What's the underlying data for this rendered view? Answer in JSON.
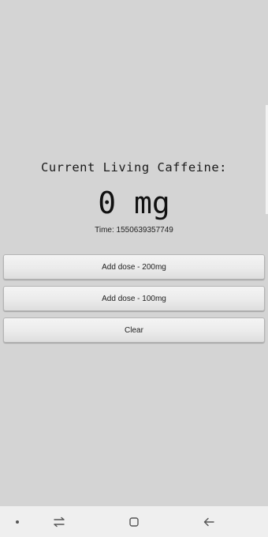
{
  "caffeine": {
    "heading": "Current Living Caffeine:",
    "amount": "0 mg",
    "time_label": "Time: ",
    "time_value": "1550639357749"
  },
  "buttons": {
    "add_200": "Add dose - 200mg",
    "add_100": "Add dose - 100mg",
    "clear": "Clear"
  },
  "navbar": {
    "icons": [
      "dot-icon",
      "recent-apps-icon",
      "home-icon",
      "back-icon"
    ]
  },
  "colors": {
    "background": "#d4d4d4",
    "button_face": "#ebebeb",
    "navbar": "#efefef"
  }
}
